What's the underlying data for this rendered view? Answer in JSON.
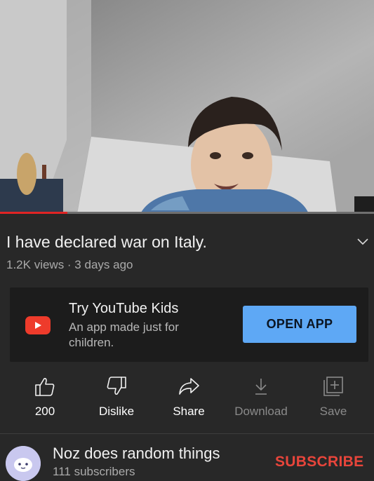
{
  "video": {
    "progress_fraction": 0.18
  },
  "title": {
    "text": "I have declared war on Italy.",
    "meta": "1.2K views · 3 days ago",
    "expand_icon": "chevron-down-icon"
  },
  "promo": {
    "title": "Try YouTube Kids",
    "subtitle": "An app made just for children.",
    "button_label": "OPEN APP",
    "logo_icon": "youtube-kids-icon"
  },
  "actions": [
    {
      "label": "200",
      "icon": "thumbs-up-icon"
    },
    {
      "label": "Dislike",
      "icon": "thumbs-down-icon"
    },
    {
      "label": "Share",
      "icon": "share-icon"
    },
    {
      "label": "Download",
      "icon": "download-icon"
    },
    {
      "label": "Save",
      "icon": "add-to-playlist-icon"
    }
  ],
  "channel": {
    "name": "Noz does random things",
    "subscribers": "111 subscribers",
    "subscribe_label": "SUBSCRIBE"
  },
  "colors": {
    "background": "#282828",
    "card": "#1c1c1c",
    "accent_button": "#5ea8f5",
    "progress": "#e02424",
    "subscribe": "#e8453b"
  }
}
